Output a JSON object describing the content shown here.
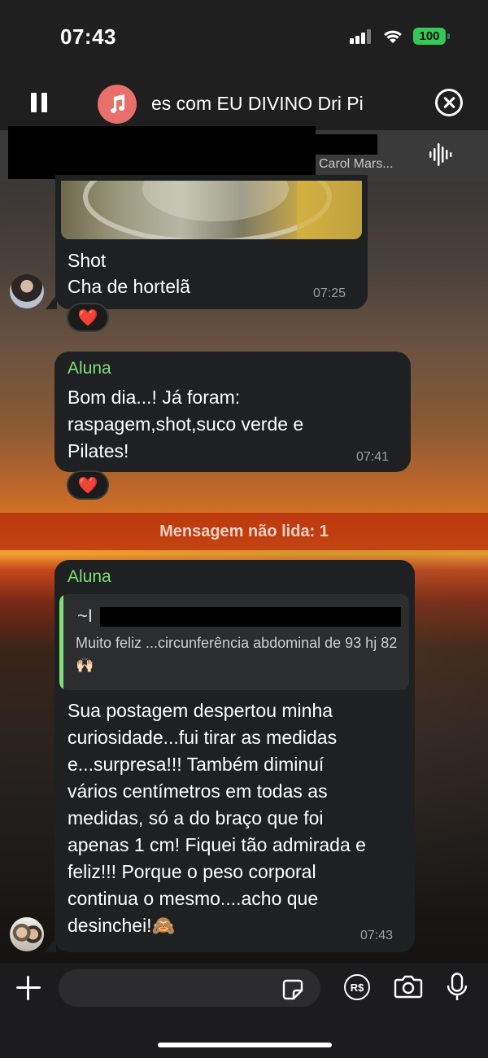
{
  "status_bar": {
    "time": "07:43",
    "battery": "100"
  },
  "player": {
    "title": "es com EU DIVINO   Dri Pi"
  },
  "header": {
    "subtitle": "Carol Mars..."
  },
  "messages": [
    {
      "lines": [
        "Shot",
        "Cha de hortelã"
      ],
      "time": "07:25",
      "reaction": "❤️"
    },
    {
      "sender": "Aluna",
      "lines": [
        "Bom dia...! Já foram:",
        "raspagem,shot,suco verde e",
        "Pilates!"
      ],
      "time": "07:41",
      "reaction": "❤️"
    }
  ],
  "unread": {
    "label": "Mensagem não lida: 1"
  },
  "reply_message": {
    "sender": "Aluna",
    "quote": {
      "name": "~I",
      "text": "Muito feliz ...circunferência abdominal de 93 hj 82🙌🏻"
    },
    "lines": [
      "Sua postagem despertou minha",
      "curiosidade...fui tirar as medidas",
      "e...surpresa!!! Também diminuí",
      "vários centímetros em todas as",
      "medidas, só a do braço que foi",
      "apenas 1 cm! Fiquei tão admirada e",
      "feliz!!! Porque o peso corporal",
      "continua o mesmo....acho que",
      "desinchei!🙈"
    ],
    "time": "07:43"
  },
  "composer": {
    "placeholder": "",
    "pix_label": "R$"
  },
  "icons": {
    "pause": "pause-icon",
    "music": "music-icon",
    "close": "close-icon",
    "waveform": "waveform-icon",
    "plus": "plus-icon",
    "sticker": "sticker-icon",
    "pix": "pix-icon",
    "camera": "camera-icon",
    "mic": "microphone-icon"
  },
  "colors": {
    "sender": "#7fe07a",
    "bubble": "#1f2021",
    "battery": "#35c759",
    "music": "#e96f6c"
  }
}
